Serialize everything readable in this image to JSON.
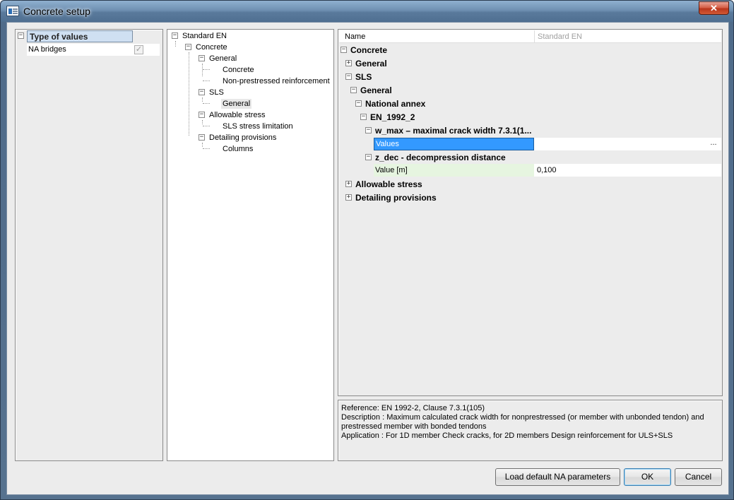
{
  "window": {
    "title": "Concrete setup",
    "close_glyph": "✕"
  },
  "left_panel": {
    "header": "Type of values",
    "item_label": "NA bridges",
    "item_checked": true,
    "check_glyph": "✓"
  },
  "tree": {
    "expand_glyph": "−",
    "items": [
      {
        "label": "Standard EN"
      },
      {
        "label": "Concrete"
      },
      {
        "label": "General"
      },
      {
        "label": "Concrete"
      },
      {
        "label": "Non-prestressed reinforcement"
      },
      {
        "label": "SLS"
      },
      {
        "label": "General"
      },
      {
        "label": "Allowable stress"
      },
      {
        "label": "SLS stress limitation"
      },
      {
        "label": "Detailing provisions"
      },
      {
        "label": "Columns"
      }
    ],
    "selected": "General"
  },
  "grid": {
    "col_name": "Name",
    "col_value": "Standard EN",
    "collapse_glyph": "−",
    "expand_glyph": "+",
    "rows": {
      "concrete": "Concrete",
      "general": "General",
      "sls": "SLS",
      "sls_general": "General",
      "national_annex": "National annex",
      "en_1992_2": "EN_1992_2",
      "w_max": "w_max – maximal crack width 7.3.1(1...",
      "values_label": "Values",
      "values_button": "...",
      "z_dec": "z_dec - decompression distance",
      "value_m_label": "Value [m]",
      "value_m": "0,100",
      "allowable_stress": "Allowable stress",
      "detailing_provisions": "Detailing provisions"
    }
  },
  "info": {
    "reference": "Reference: EN 1992-2, Clause 7.3.1(105)",
    "description_1": "Description : Maximum calculated crack width for nonprestressed (or member with unbonded tendon) and",
    "description_2": "prestressed member with bonded tendons",
    "application": "Application : For 1D member Check cracks, for 2D members Design reinforcement for ULS+SLS"
  },
  "buttons": {
    "load_default": "Load default NA parameters",
    "ok": "OK",
    "cancel": "Cancel"
  }
}
